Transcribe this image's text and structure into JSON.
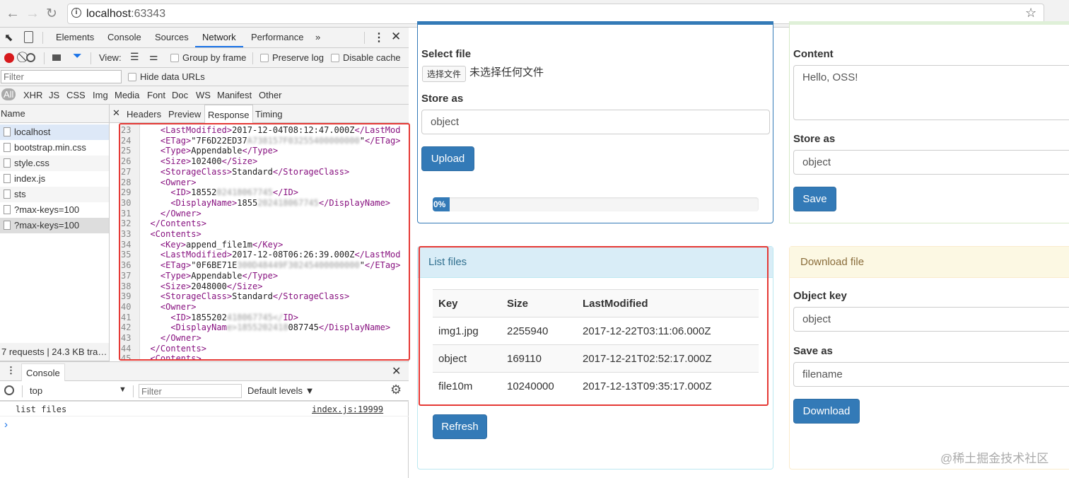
{
  "browser": {
    "back_icon": "arrow-left-icon",
    "forward_icon": "arrow-right-icon",
    "reload_icon": "reload-icon",
    "url_host": "localhost",
    "url_port": ":63343",
    "star_icon": "star-icon"
  },
  "devtools": {
    "tabs": [
      "Elements",
      "Console",
      "Sources",
      "Network",
      "Performance"
    ],
    "active_tab": "Network",
    "more": "»",
    "view_label": "View:",
    "group_by_frame": "Group by frame",
    "preserve_log": "Preserve log",
    "disable_cache": "Disable cache",
    "filter_placeholder": "Filter",
    "hide_data_urls": "Hide data URLs",
    "types": [
      "All",
      "XHR",
      "JS",
      "CSS",
      "Img",
      "Media",
      "Font",
      "Doc",
      "WS",
      "Manifest",
      "Other"
    ],
    "name_header": "Name",
    "detail_tabs": [
      "Headers",
      "Preview",
      "Response",
      "Timing"
    ],
    "active_detail_tab": "Response",
    "requests": [
      "localhost",
      "bootstrap.min.css",
      "style.css",
      "index.js",
      "sts",
      "?max-keys=100",
      "?max-keys=100"
    ],
    "status": "7 requests | 24.3 KB tra…",
    "code_lines": [
      {
        "n": "23",
        "indent": "    ",
        "segs": [
          [
            "tg",
            "<LastModified>"
          ],
          [
            "tx",
            "2017-12-04T08:12:47.000Z"
          ],
          [
            "tg",
            "</LastMod"
          ]
        ]
      },
      {
        "n": "24",
        "indent": "    ",
        "segs": [
          [
            "tg",
            "<ETag>"
          ],
          [
            "tx",
            "\"7F6D22ED37"
          ],
          [
            "bl",
            "A738157F03255400000000"
          ],
          [
            "tx",
            "\""
          ],
          [
            "tg",
            "</ETag>"
          ]
        ]
      },
      {
        "n": "25",
        "indent": "    ",
        "segs": [
          [
            "tg",
            "<Type>"
          ],
          [
            "tx",
            "Appendable"
          ],
          [
            "tg",
            "</Type>"
          ]
        ]
      },
      {
        "n": "26",
        "indent": "    ",
        "segs": [
          [
            "tg",
            "<Size>"
          ],
          [
            "tx",
            "102400"
          ],
          [
            "tg",
            "</Size>"
          ]
        ]
      },
      {
        "n": "27",
        "indent": "    ",
        "segs": [
          [
            "tg",
            "<StorageClass>"
          ],
          [
            "tx",
            "Standard"
          ],
          [
            "tg",
            "</StorageClass>"
          ]
        ]
      },
      {
        "n": "28",
        "indent": "    ",
        "segs": [
          [
            "tg",
            "<Owner>"
          ]
        ]
      },
      {
        "n": "29",
        "indent": "      ",
        "segs": [
          [
            "tg",
            "<ID>"
          ],
          [
            "tx",
            "18552"
          ],
          [
            "bl",
            "02418067745"
          ],
          [
            "tg",
            "</ID>"
          ]
        ]
      },
      {
        "n": "30",
        "indent": "      ",
        "segs": [
          [
            "tg",
            "<DisplayName>"
          ],
          [
            "tx",
            "1855"
          ],
          [
            "bl",
            "202418067745"
          ],
          [
            "tg",
            "</DisplayName>"
          ]
        ]
      },
      {
        "n": "31",
        "indent": "    ",
        "segs": [
          [
            "tg",
            "</Owner>"
          ]
        ]
      },
      {
        "n": "32",
        "indent": "  ",
        "segs": [
          [
            "tg",
            "</Contents>"
          ]
        ]
      },
      {
        "n": "33",
        "indent": "  ",
        "segs": [
          [
            "tg",
            "<Contents>"
          ]
        ]
      },
      {
        "n": "34",
        "indent": "    ",
        "segs": [
          [
            "tg",
            "<Key>"
          ],
          [
            "tx",
            "append_file1m"
          ],
          [
            "tg",
            "</Key>"
          ]
        ]
      },
      {
        "n": "35",
        "indent": "    ",
        "segs": [
          [
            "tg",
            "<LastModified>"
          ],
          [
            "tx",
            "2017-12-08T06:26:39.000Z"
          ],
          [
            "tg",
            "</LastMod"
          ]
        ]
      },
      {
        "n": "36",
        "indent": "    ",
        "segs": [
          [
            "tg",
            "<ETag>"
          ],
          [
            "tx",
            "\"0F6BE71E"
          ],
          [
            "bl",
            "300D48449F30245400000000"
          ],
          [
            "tx",
            "\""
          ],
          [
            "tg",
            "</ETag>"
          ]
        ]
      },
      {
        "n": "37",
        "indent": "    ",
        "segs": [
          [
            "tg",
            "<Type>"
          ],
          [
            "tx",
            "Appendable"
          ],
          [
            "tg",
            "</Type>"
          ]
        ]
      },
      {
        "n": "38",
        "indent": "    ",
        "segs": [
          [
            "tg",
            "<Size>"
          ],
          [
            "tx",
            "2048000"
          ],
          [
            "tg",
            "</Size>"
          ]
        ]
      },
      {
        "n": "39",
        "indent": "    ",
        "segs": [
          [
            "tg",
            "<StorageClass>"
          ],
          [
            "tx",
            "Standard"
          ],
          [
            "tg",
            "</StorageClass>"
          ]
        ]
      },
      {
        "n": "40",
        "indent": "    ",
        "segs": [
          [
            "tg",
            "<Owner>"
          ]
        ]
      },
      {
        "n": "41",
        "indent": "      ",
        "segs": [
          [
            "tg",
            "<ID>"
          ],
          [
            "tx",
            "1855202"
          ],
          [
            "bl",
            "418067745</"
          ],
          [
            "tg",
            "ID>"
          ]
        ]
      },
      {
        "n": "42",
        "indent": "      ",
        "segs": [
          [
            "tg",
            "<DisplayNam"
          ],
          [
            "bl",
            "e>1855202418"
          ],
          [
            "tx",
            "087745"
          ],
          [
            "tg",
            "</DisplayName>"
          ]
        ]
      },
      {
        "n": "43",
        "indent": "    ",
        "segs": [
          [
            "tg",
            "</Owner>"
          ]
        ]
      },
      {
        "n": "44",
        "indent": "  ",
        "segs": [
          [
            "tg",
            "</Contents>"
          ]
        ]
      },
      {
        "n": "45",
        "indent": "  ",
        "segs": [
          [
            "tg",
            "<Contents>"
          ]
        ]
      }
    ],
    "console": {
      "tab": "Console",
      "context": "top",
      "filter_placeholder": "Filter",
      "levels": "Default levels ▼",
      "message": "list files",
      "source": "index.js:19999",
      "prompt": "›"
    }
  },
  "page": {
    "upload": {
      "select_label": "Select file",
      "choose_button": "选择文件",
      "no_file": "未选择任何文件",
      "store_label": "Store as",
      "store_value": "object",
      "upload_button": "Upload",
      "progress_text": "0%",
      "progress": 0
    },
    "save": {
      "content_label": "Content",
      "content_value": "Hello, OSS!",
      "store_label": "Store as",
      "store_value": "object",
      "save_button": "Save"
    },
    "list": {
      "title": "List files",
      "headers": [
        "Key",
        "Size",
        "LastModified"
      ],
      "rows": [
        [
          "img1.jpg",
          "2255940",
          "2017-12-22T03:11:06.000Z"
        ],
        [
          "object",
          "169110",
          "2017-12-21T02:52:17.000Z"
        ],
        [
          "file10m",
          "10240000",
          "2017-12-13T09:35:17.000Z"
        ]
      ],
      "refresh_button": "Refresh"
    },
    "download": {
      "title": "Download file",
      "key_label": "Object key",
      "key_value": "object",
      "saveas_label": "Save as",
      "saveas_value": "filename",
      "download_button": "Download"
    },
    "watermark": "@稀土掘金技术社区",
    "colors": {
      "primary": "#337ab7",
      "info_bg": "#d9edf7",
      "warning_bg": "#fcf8e3",
      "success_border": "#d6e9c6",
      "highlight": "#e53935"
    }
  }
}
